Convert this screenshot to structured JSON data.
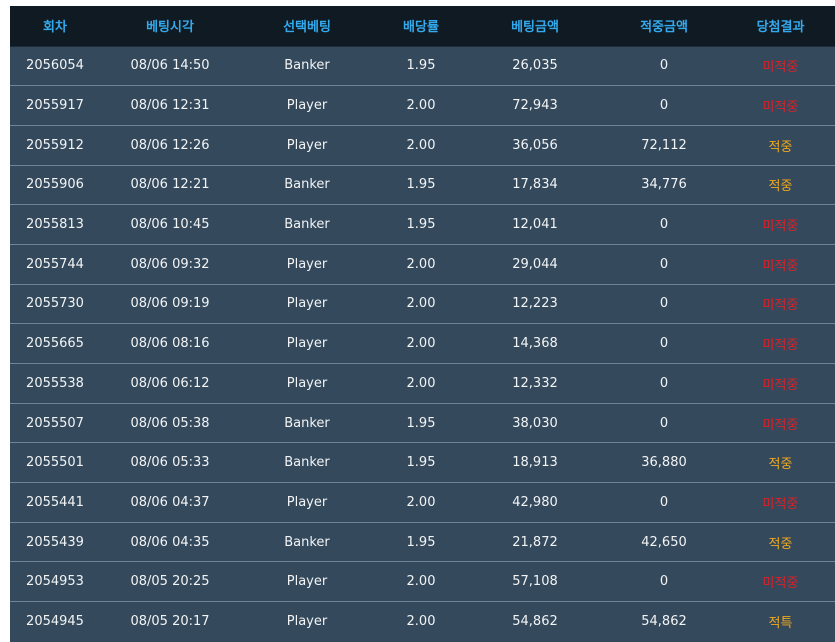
{
  "headers": [
    "회차",
    "베팅시각",
    "선택베팅",
    "배당률",
    "베팅금액",
    "적중금액",
    "당첨결과"
  ],
  "colors": {
    "header_bg": "#0f1a23",
    "header_text": "#33aaee",
    "row_bg": "#34495b",
    "row_text": "#f2f4f6",
    "lose": "#d8222a",
    "win": "#f0a91c"
  },
  "rows": [
    {
      "round": "2056054",
      "time": "08/06 14:50",
      "pick": "Banker",
      "odds": "1.95",
      "bet": "26,035",
      "win_amount": "0",
      "result": "미적중",
      "status": "lose"
    },
    {
      "round": "2055917",
      "time": "08/06 12:31",
      "pick": "Player",
      "odds": "2.00",
      "bet": "72,943",
      "win_amount": "0",
      "result": "미적중",
      "status": "lose"
    },
    {
      "round": "2055912",
      "time": "08/06 12:26",
      "pick": "Player",
      "odds": "2.00",
      "bet": "36,056",
      "win_amount": "72,112",
      "result": "적중",
      "status": "win"
    },
    {
      "round": "2055906",
      "time": "08/06 12:21",
      "pick": "Banker",
      "odds": "1.95",
      "bet": "17,834",
      "win_amount": "34,776",
      "result": "적중",
      "status": "win"
    },
    {
      "round": "2055813",
      "time": "08/06 10:45",
      "pick": "Banker",
      "odds": "1.95",
      "bet": "12,041",
      "win_amount": "0",
      "result": "미적중",
      "status": "lose"
    },
    {
      "round": "2055744",
      "time": "08/06 09:32",
      "pick": "Player",
      "odds": "2.00",
      "bet": "29,044",
      "win_amount": "0",
      "result": "미적중",
      "status": "lose"
    },
    {
      "round": "2055730",
      "time": "08/06 09:19",
      "pick": "Player",
      "odds": "2.00",
      "bet": "12,223",
      "win_amount": "0",
      "result": "미적중",
      "status": "lose"
    },
    {
      "round": "2055665",
      "time": "08/06 08:16",
      "pick": "Player",
      "odds": "2.00",
      "bet": "14,368",
      "win_amount": "0",
      "result": "미적중",
      "status": "lose"
    },
    {
      "round": "2055538",
      "time": "08/06 06:12",
      "pick": "Player",
      "odds": "2.00",
      "bet": "12,332",
      "win_amount": "0",
      "result": "미적중",
      "status": "lose"
    },
    {
      "round": "2055507",
      "time": "08/06 05:38",
      "pick": "Banker",
      "odds": "1.95",
      "bet": "38,030",
      "win_amount": "0",
      "result": "미적중",
      "status": "lose"
    },
    {
      "round": "2055501",
      "time": "08/06 05:33",
      "pick": "Banker",
      "odds": "1.95",
      "bet": "18,913",
      "win_amount": "36,880",
      "result": "적중",
      "status": "win"
    },
    {
      "round": "2055441",
      "time": "08/06 04:37",
      "pick": "Player",
      "odds": "2.00",
      "bet": "42,980",
      "win_amount": "0",
      "result": "미적중",
      "status": "lose"
    },
    {
      "round": "2055439",
      "time": "08/06 04:35",
      "pick": "Banker",
      "odds": "1.95",
      "bet": "21,872",
      "win_amount": "42,650",
      "result": "적중",
      "status": "win"
    },
    {
      "round": "2054953",
      "time": "08/05 20:25",
      "pick": "Player",
      "odds": "2.00",
      "bet": "57,108",
      "win_amount": "0",
      "result": "미적중",
      "status": "lose"
    },
    {
      "round": "2054945",
      "time": "08/05 20:17",
      "pick": "Player",
      "odds": "2.00",
      "bet": "54,862",
      "win_amount": "54,862",
      "result": "적특",
      "status": "win"
    }
  ]
}
